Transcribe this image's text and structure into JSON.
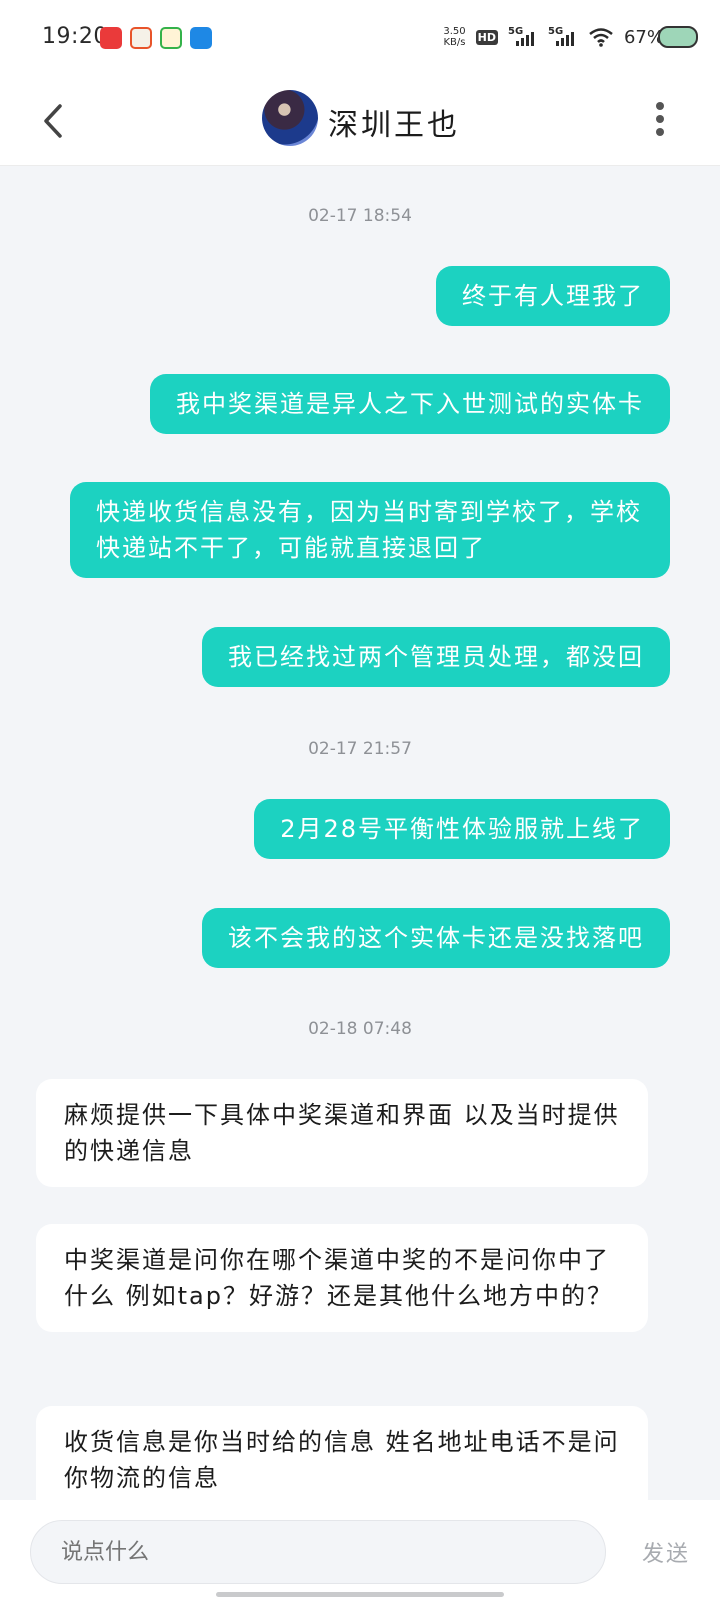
{
  "status_bar": {
    "time": "19:20",
    "net_speed_value": "3.50",
    "net_speed_unit": "KB/s",
    "hd_label": "HD",
    "sim1_label": "5G",
    "sim2_label": "5G",
    "battery": "67%"
  },
  "header": {
    "title": "深圳王也"
  },
  "messages": [
    {
      "type": "timestamp",
      "text": "02-17 18:54"
    },
    {
      "type": "outgoing",
      "text": "终于有人理我了"
    },
    {
      "type": "outgoing",
      "text": "我中奖渠道是异人之下入世测试的实体卡"
    },
    {
      "type": "outgoing",
      "text": "快递收货信息没有，因为当时寄到学校了，学校快递站不干了，可能就直接退回了"
    },
    {
      "type": "outgoing",
      "text": "我已经找过两个管理员处理，都没回"
    },
    {
      "type": "timestamp",
      "text": "02-17 21:57"
    },
    {
      "type": "outgoing",
      "text": "2月28号平衡性体验服就上线了"
    },
    {
      "type": "outgoing",
      "text": "该不会我的这个实体卡还是没找落吧"
    },
    {
      "type": "timestamp",
      "text": "02-18 07:48"
    },
    {
      "type": "incoming",
      "text": "麻烦提供一下具体中奖渠道和界面 以及当时提供的快递信息"
    },
    {
      "type": "incoming",
      "text": "中奖渠道是问你在哪个渠道中奖的不是问你中了什么 例如tap？好游？还是其他什么地方中的？"
    },
    {
      "type": "incoming",
      "text": "收货信息是你当时给的信息 姓名地址电话不是问你物流的信息"
    }
  ],
  "composer": {
    "placeholder": "说点什么",
    "send_label": "发送"
  },
  "colors": {
    "outgoing_bubble": "#1cd2c1",
    "incoming_bubble": "#ffffff",
    "background": "#f3f5f8"
  }
}
